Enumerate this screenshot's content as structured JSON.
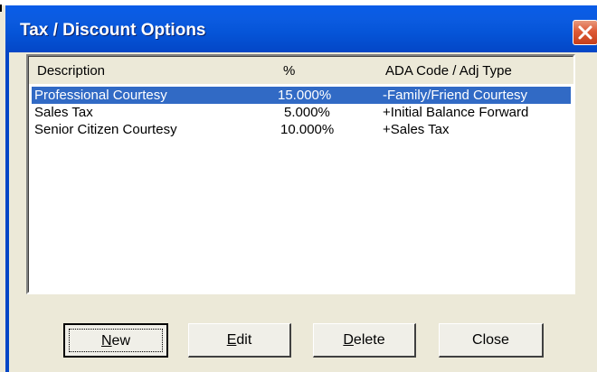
{
  "window": {
    "title": "Tax / Discount Options"
  },
  "list": {
    "columns": [
      "Description",
      "%",
      "ADA Code / Adj Type"
    ],
    "rows": [
      {
        "description": "Professional Courtesy",
        "percent": "15.000%",
        "code": "-Family/Friend Courtesy",
        "selected": true
      },
      {
        "description": "Sales Tax",
        "percent": "5.000%",
        "code": "+Initial Balance Forward",
        "selected": false
      },
      {
        "description": "Senior Citizen Courtesy",
        "percent": "10.000%",
        "code": "+Sales Tax",
        "selected": false
      }
    ]
  },
  "buttons": {
    "new": {
      "mnemonic": "N",
      "rest": "ew"
    },
    "edit": {
      "mnemonic": "E",
      "rest": "dit"
    },
    "delete": {
      "mnemonic": "D",
      "rest": "elete"
    },
    "close": {
      "label": "Close"
    }
  },
  "colors": {
    "titlebar": "#0554d7",
    "selection": "#316ac5",
    "close": "#dd5a36"
  }
}
